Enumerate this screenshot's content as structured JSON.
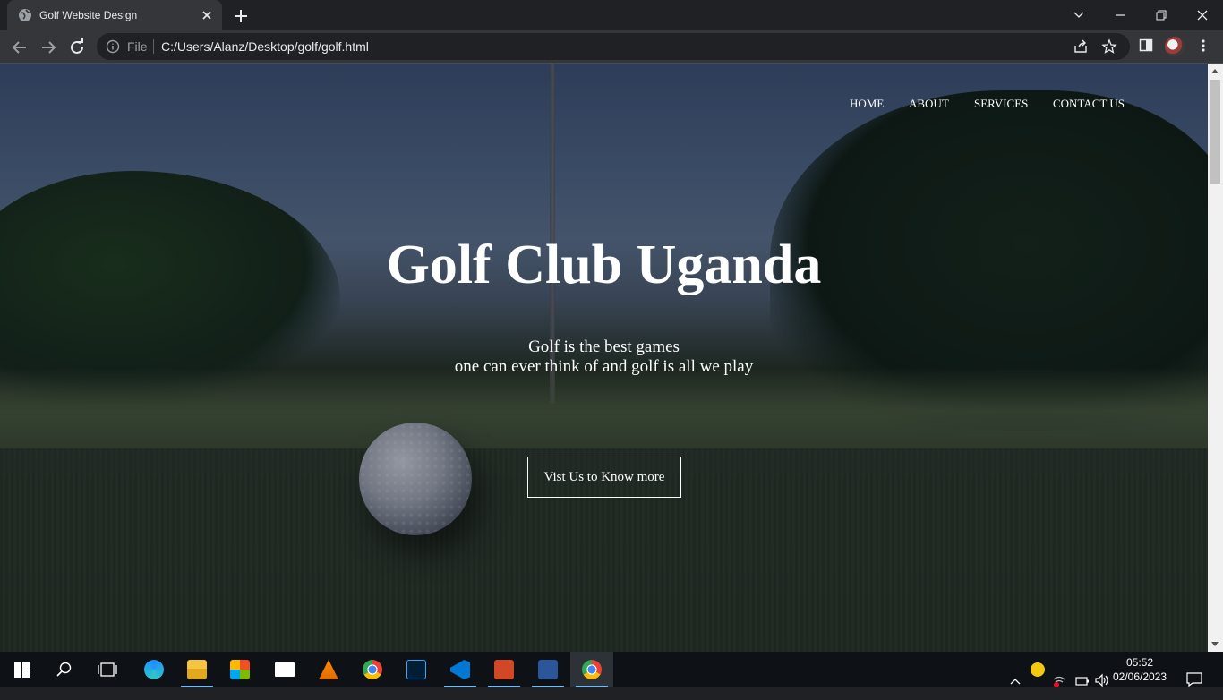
{
  "browser": {
    "tab_title": "Golf Website Design",
    "omnibox_scheme": "File",
    "url": "C:/Users/Alanz/Desktop/golf/golf.html"
  },
  "site": {
    "nav": [
      "HOME",
      "ABOUT",
      "SERVICES",
      "CONTACT US"
    ],
    "title": "Golf Club Uganda",
    "subtitle_line1": "Golf is the best games",
    "subtitle_line2": "one can ever think of and golf is all we play",
    "cta_label": "Vist Us to Know more"
  },
  "taskbar": {
    "apps": [
      "edge-icon",
      "file-explorer-icon",
      "store-icon",
      "mail-icon",
      "vlc-icon",
      "chrome-icon",
      "photoshop-icon",
      "vscode-icon",
      "powerpoint-icon",
      "word-icon",
      "chrome-active-icon"
    ],
    "time": "05:52",
    "date": "02/06/2023"
  },
  "colors": {
    "chrome_dark": "#202124",
    "chrome_toolbar": "#35363a",
    "taskbar": "#0e1116",
    "accent_underline": "#76b9ed"
  }
}
